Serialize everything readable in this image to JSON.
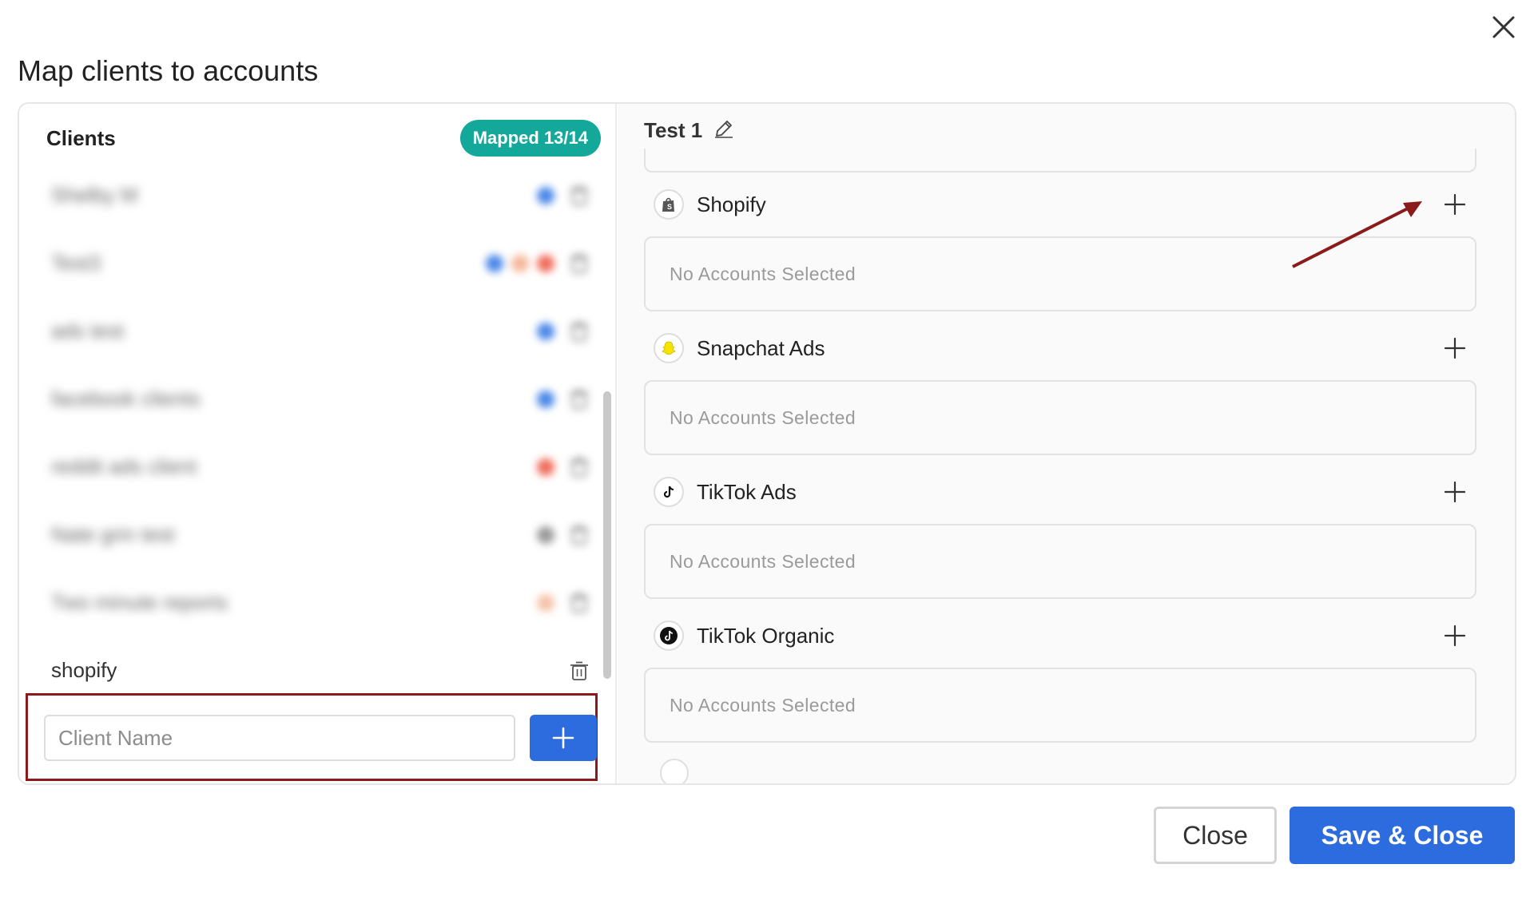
{
  "dialog": {
    "title": "Map clients to accounts"
  },
  "clients_panel": {
    "title": "Clients",
    "mapped_badge": "Mapped 13/14",
    "items": [
      {
        "name": "Shelby M",
        "blurred": true,
        "dots": [
          "#4a86e8"
        ]
      },
      {
        "name": "Test3",
        "blurred": true,
        "dots": [
          "#4a86e8",
          "#f5b79a",
          "#ef6b5a"
        ]
      },
      {
        "name": "ads test",
        "blurred": true,
        "dots": [
          "#4a86e8"
        ]
      },
      {
        "name": "facebook clients",
        "blurred": true,
        "dots": [
          "#4a86e8"
        ]
      },
      {
        "name": "reddit ads client",
        "blurred": true,
        "dots": [
          "#ef6b5a"
        ]
      },
      {
        "name": "Nate grin test",
        "blurred": true,
        "dots": [
          "#999999"
        ]
      },
      {
        "name": "Two minute reports",
        "blurred": true,
        "dots": [
          "#f5c2a8"
        ]
      },
      {
        "name": "shopify",
        "blurred": false,
        "dots": []
      }
    ],
    "input_placeholder": "Client Name"
  },
  "mapping_panel": {
    "client_title": "Test 1",
    "platforms": [
      {
        "name": "Shopify",
        "accounts_text": "No Accounts Selected",
        "icon": "shopify-icon"
      },
      {
        "name": "Snapchat Ads",
        "accounts_text": "No Accounts Selected",
        "icon": "snapchat-icon"
      },
      {
        "name": "TikTok Ads",
        "accounts_text": "No Accounts Selected",
        "icon": "tiktok-icon"
      },
      {
        "name": "TikTok Organic",
        "accounts_text": "No Accounts Selected",
        "icon": "tiktok-organic-icon"
      }
    ]
  },
  "footer": {
    "close_label": "Close",
    "save_label": "Save & Close"
  },
  "colors": {
    "accent_blue": "#2d6cdf",
    "badge_teal": "#14a89a",
    "highlight_red": "#8b1a1a"
  }
}
